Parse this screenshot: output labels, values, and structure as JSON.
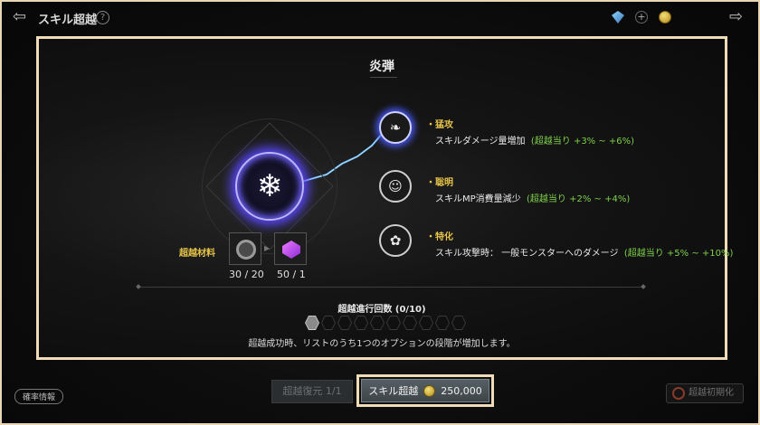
{
  "header": {
    "title": "スキル超越",
    "help": "?"
  },
  "panel": {
    "skill_name": "炎弾",
    "materials": {
      "label": "超越材料",
      "items": [
        {
          "count": "30 / 20"
        },
        {
          "count": "50 / 1"
        }
      ]
    },
    "options": [
      {
        "title": "・猛攻",
        "desc": "スキルダメージ量増加",
        "range": "(超越当り +3% ~ +6%)"
      },
      {
        "title": "・聡明",
        "desc": "スキルMP消費量減少",
        "range": "(超越当り +2% ~ +4%)"
      },
      {
        "title": "・特化",
        "desc": "スキル攻撃時： 一般モンスターへのダメージ",
        "range": "(超越当り +5% ~ +10%)"
      }
    ],
    "progress": {
      "label": "超越進行回数 (0/10)",
      "filled": 1,
      "total": 10
    },
    "note": "超越成功時、リストのうち1つのオプションの段階が増加します。"
  },
  "footer": {
    "probability": "確率情報",
    "restore": "超越復元 1/1",
    "transcend": "スキル超越",
    "cost": "250,000",
    "reset": "超越初期化"
  }
}
